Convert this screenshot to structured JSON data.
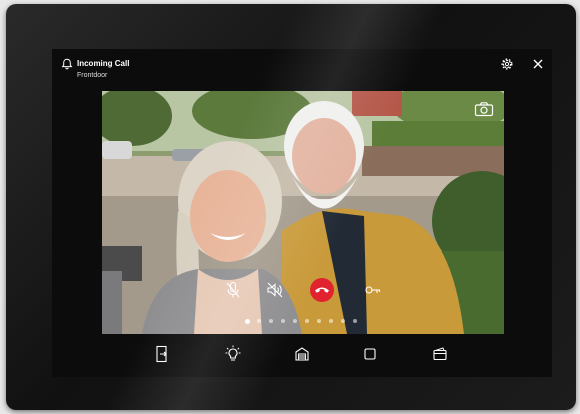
{
  "header": {
    "title": "Incoming Call",
    "subtitle": "Frontdoor"
  },
  "icons": {
    "bell": "bell-icon",
    "settings": "gear-icon",
    "close": "close-icon",
    "camera": "camera-icon",
    "mic": "mic-off-icon",
    "speaker": "speaker-off-icon",
    "hangup": "phone-hangup-icon",
    "key": "key-icon",
    "bottom": [
      "door-opener-icon",
      "light-icon",
      "garage-icon",
      "square-icon",
      "wallet-icon"
    ]
  },
  "pagination": {
    "count": 10,
    "active": 0
  },
  "colors": {
    "hangup": "#e0232f",
    "screen": "#0c0c0c",
    "text": "#ffffff"
  }
}
